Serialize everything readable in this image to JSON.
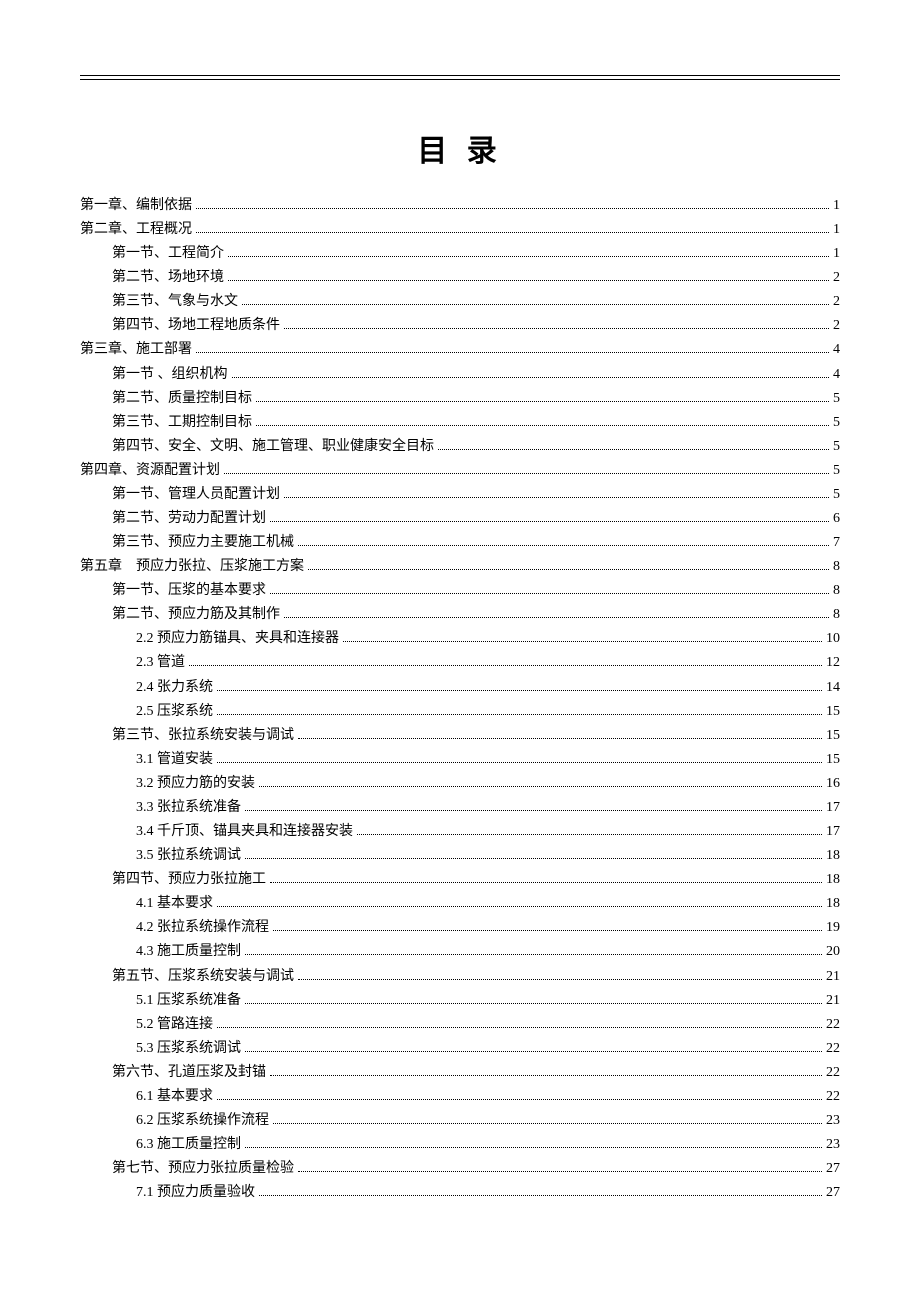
{
  "title": "目 录",
  "toc": [
    {
      "label": "第一章、编制依据",
      "page": "1",
      "level": 0
    },
    {
      "label": "第二章、工程概况",
      "page": "1",
      "level": 0
    },
    {
      "label": "第一节、工程简介",
      "page": "1",
      "level": 1
    },
    {
      "label": "第二节、场地环境",
      "page": "2",
      "level": 1
    },
    {
      "label": "第三节、气象与水文",
      "page": "2",
      "level": 1
    },
    {
      "label": "第四节、场地工程地质条件",
      "page": "2",
      "level": 1
    },
    {
      "label": "第三章、施工部署",
      "page": "4",
      "level": 0
    },
    {
      "label": "第一节 、组织机构",
      "page": "4",
      "level": 1
    },
    {
      "label": "第二节、质量控制目标",
      "page": "5",
      "level": 1
    },
    {
      "label": "第三节、工期控制目标",
      "page": "5",
      "level": 1
    },
    {
      "label": "第四节、安全、文明、施工管理、职业健康安全目标",
      "page": "5",
      "level": 1
    },
    {
      "label": "第四章、资源配置计划",
      "page": "5",
      "level": 0
    },
    {
      "label": "第一节、管理人员配置计划",
      "page": "5",
      "level": 1
    },
    {
      "label": "第二节、劳动力配置计划",
      "page": "6",
      "level": 1
    },
    {
      "label": "第三节、预应力主要施工机械",
      "page": "7",
      "level": 1
    },
    {
      "label": "第五章　预应力张拉、压浆施工方案",
      "page": "8",
      "level": 0
    },
    {
      "label": "第一节、压浆的基本要求",
      "page": "8",
      "level": 1
    },
    {
      "label": "第二节、预应力筋及其制作",
      "page": "8",
      "level": 1
    },
    {
      "label": "2.2 预应力筋锚具、夹具和连接器",
      "page": "10",
      "level": 2
    },
    {
      "label": "2.3 管道",
      "page": "12",
      "level": 2
    },
    {
      "label": "2.4 张力系统",
      "page": "14",
      "level": 2
    },
    {
      "label": "2.5 压浆系统",
      "page": "15",
      "level": 2
    },
    {
      "label": "第三节、张拉系统安装与调试",
      "page": "15",
      "level": 1
    },
    {
      "label": "3.1 管道安装",
      "page": "15",
      "level": 2
    },
    {
      "label": "3.2 预应力筋的安装",
      "page": "16",
      "level": 2
    },
    {
      "label": "3.3 张拉系统准备",
      "page": "17",
      "level": 2
    },
    {
      "label": "3.4 千斤顶、锚具夹具和连接器安装",
      "page": "17",
      "level": 2
    },
    {
      "label": "3.5 张拉系统调试",
      "page": "18",
      "level": 2
    },
    {
      "label": "第四节、预应力张拉施工",
      "page": "18",
      "level": 1
    },
    {
      "label": "4.1 基本要求",
      "page": "18",
      "level": 2
    },
    {
      "label": "4.2 张拉系统操作流程",
      "page": "19",
      "level": 2
    },
    {
      "label": "4.3 施工质量控制",
      "page": "20",
      "level": 2
    },
    {
      "label": "第五节、压浆系统安装与调试",
      "page": "21",
      "level": 1
    },
    {
      "label": "5.1 压浆系统准备",
      "page": "21",
      "level": 2
    },
    {
      "label": "5.2 管路连接",
      "page": "22",
      "level": 2
    },
    {
      "label": "5.3 压浆系统调试",
      "page": "22",
      "level": 2
    },
    {
      "label": "第六节、孔道压浆及封锚",
      "page": "22",
      "level": 1
    },
    {
      "label": "6.1 基本要求",
      "page": "22",
      "level": 2
    },
    {
      "label": "6.2 压浆系统操作流程",
      "page": "23",
      "level": 2
    },
    {
      "label": "6.3 施工质量控制",
      "page": "23",
      "level": 2
    },
    {
      "label": "第七节、预应力张拉质量检验",
      "page": "27",
      "level": 1
    },
    {
      "label": "7.1 预应力质量验收",
      "page": "27",
      "level": 2
    }
  ]
}
